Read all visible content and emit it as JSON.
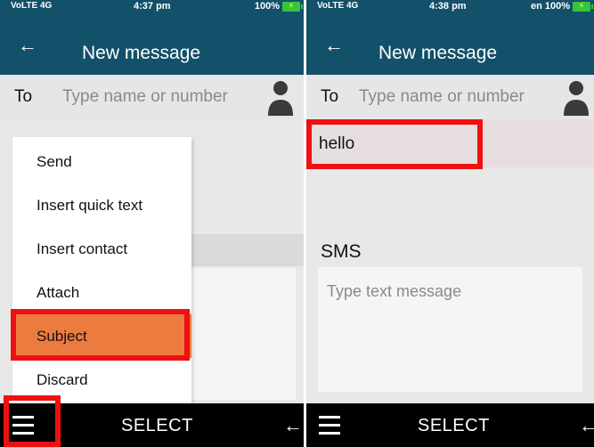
{
  "left": {
    "status": {
      "signal": "VoLTE 4G",
      "time": "4:37 pm",
      "battery": "100%"
    },
    "header": {
      "title": "New message"
    },
    "to_field": {
      "label": "To",
      "placeholder": "Type name or number"
    },
    "menu": {
      "items": [
        {
          "label": "Send"
        },
        {
          "label": "Insert quick text"
        },
        {
          "label": "Insert contact"
        },
        {
          "label": "Attach"
        },
        {
          "label": "Subject"
        },
        {
          "label": "Discard"
        }
      ],
      "selected": "Subject"
    },
    "softkeys": {
      "center": "SELECT"
    }
  },
  "right": {
    "status": {
      "signal": "VoLTE 4G",
      "time": "4:38 pm",
      "battery": "en 100%"
    },
    "header": {
      "title": "New message"
    },
    "to_field": {
      "label": "To",
      "placeholder": "Type name or number"
    },
    "subject": {
      "value": "hello"
    },
    "sms": {
      "label": "SMS",
      "placeholder": "Type text message"
    },
    "softkeys": {
      "center": "SELECT"
    }
  },
  "colors": {
    "header": "#13506a",
    "selected_menu": "#ec7b40",
    "highlight": "#ee1111",
    "battery": "#35c53a"
  }
}
